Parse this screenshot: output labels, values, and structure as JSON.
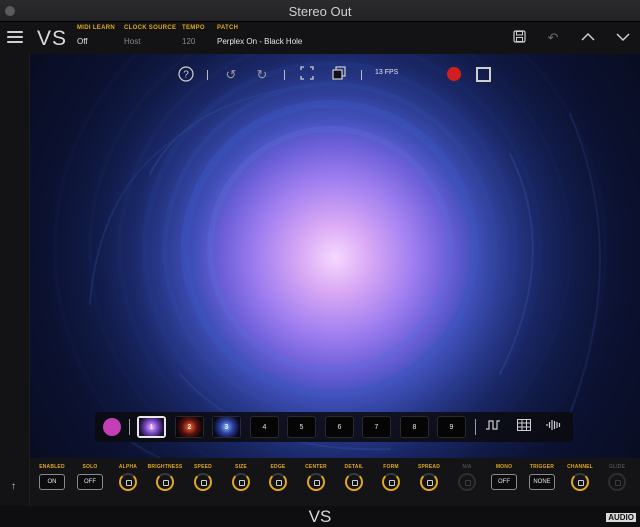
{
  "window": {
    "title": "Stereo Out"
  },
  "header": {
    "logo": "VS",
    "fields": [
      {
        "label": "MIDI LEARN",
        "value": "Off"
      },
      {
        "label": "CLOCK SOURCE",
        "value": "Host"
      },
      {
        "label": "TEMPO",
        "value": "120"
      },
      {
        "label": "PATCH",
        "value": "Perplex On - Black Hole"
      }
    ],
    "icons": [
      "save-icon",
      "undo-icon",
      "chevron-up-icon",
      "chevron-down-icon"
    ]
  },
  "toolbar": {
    "fps": "13 FPS",
    "record_color": "#d11f1f"
  },
  "layers": {
    "color": "#c33fb8",
    "slots": [
      "1",
      "2",
      "3",
      "4",
      "5",
      "6",
      "7",
      "8",
      "9"
    ],
    "active_slot": "1"
  },
  "controls": [
    {
      "label": "ENABLED",
      "type": "toggle",
      "value": "ON"
    },
    {
      "label": "SOLO",
      "type": "toggle",
      "value": "OFF"
    },
    {
      "label": "ALPHA",
      "type": "knob"
    },
    {
      "label": "BRIGHTNESS",
      "type": "knob"
    },
    {
      "label": "SPEED",
      "type": "knob"
    },
    {
      "label": "SIZE",
      "type": "knob"
    },
    {
      "label": "EDGE",
      "type": "knob"
    },
    {
      "label": "CENTER",
      "type": "knob"
    },
    {
      "label": "DETAIL",
      "type": "knob"
    },
    {
      "label": "FORM",
      "type": "knob"
    },
    {
      "label": "SPREAD",
      "type": "knob"
    },
    {
      "label": "N/A",
      "type": "knob-disabled"
    },
    {
      "label": "MONO",
      "type": "toggle",
      "value": "OFF"
    },
    {
      "label": "TRIGGER",
      "type": "toggle",
      "value": "NONE"
    },
    {
      "label": "CHANNEL",
      "type": "knob"
    },
    {
      "label": "GLIDE",
      "type": "knob-disabled"
    }
  ],
  "footer": {
    "logo": "VS",
    "badge": "AUDIO"
  },
  "accent_color": "#e0a91d"
}
